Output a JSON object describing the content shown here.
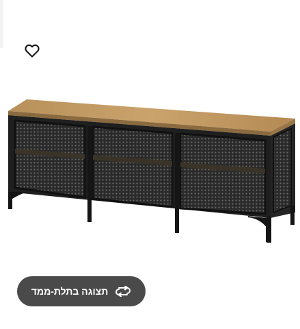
{
  "wishlist": {
    "icon": "heart-outline-icon"
  },
  "product": {
    "image": "tv-bench-black-metal-mesh-wood-top"
  },
  "view_3d": {
    "label": "תצוגה בתלת-ממד",
    "icon": "rotate-3d-icon",
    "background": "#4a4a4a",
    "text_color": "#ffffff"
  }
}
